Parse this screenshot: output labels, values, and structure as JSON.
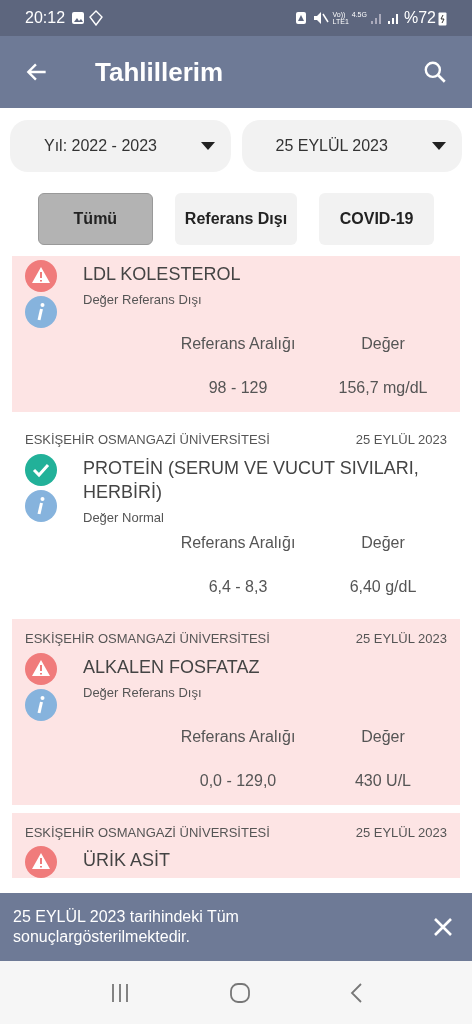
{
  "status_bar": {
    "time": "20:12",
    "volte": "Vo))",
    "lte": "LTE1",
    "network": "4.5G",
    "battery": "%72"
  },
  "app_bar": {
    "title": "Tahlillerim"
  },
  "filters": [
    {
      "label": "Yıl: 2022 - 2023"
    },
    {
      "label": "25 EYLÜL 2023"
    }
  ],
  "tabs": [
    {
      "label": "Tümü",
      "selected": true
    },
    {
      "label": "Referans Dışı",
      "selected": false
    },
    {
      "label": "COVID-19",
      "selected": false
    }
  ],
  "results": [
    {
      "kind": "abnormal",
      "test": "LDL KOLESTEROL",
      "note": "Değer Referans Dışı",
      "range_label": "Referans Aralığı",
      "value_label": "Değer",
      "range": "98 - 129",
      "value": "156,7 mg/dL"
    },
    {
      "hospital": "ESKİŞEHİR OSMANGAZİ ÜNİVERSİTESİ",
      "date": "25 EYLÜL 2023",
      "kind": "normal",
      "test": "PROTEİN (SERUM VE VUCUT SIVILARI, HERBİRİ)",
      "note": "Değer Normal",
      "range_label": "Referans Aralığı",
      "value_label": "Değer",
      "range": "6,4 - 8,3",
      "value": "6,40 g/dL"
    },
    {
      "hospital": "ESKİŞEHİR OSMANGAZİ ÜNİVERSİTESİ",
      "date": "25 EYLÜL 2023",
      "kind": "abnormal",
      "test": "ALKALEN FOSFATAZ",
      "note": "Değer Referans Dışı",
      "range_label": "Referans Aralığı",
      "value_label": "Değer",
      "range": "0,0 - 129,0",
      "value": "430 U/L"
    },
    {
      "hospital": "ESKİŞEHİR OSMANGAZİ ÜNİVERSİTESİ",
      "date": "25 EYLÜL 2023",
      "kind": "abnormal",
      "test": "ÜRİK ASİT"
    }
  ],
  "snackbar": {
    "message": "25 EYLÜL 2023 tarihindeki Tüm sonuçlargösterilmektedir."
  }
}
